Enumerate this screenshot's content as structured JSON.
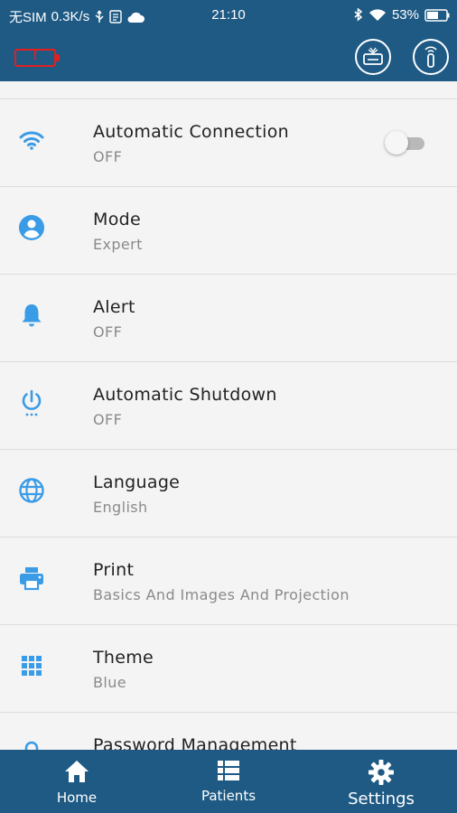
{
  "status_bar": {
    "carrier": "无SIM",
    "speed": "0.3K/s",
    "time": "21:10",
    "battery_percent": "53%"
  },
  "app_bar": {
    "battery_warning_symbol": "!"
  },
  "settings": [
    {
      "icon": "wifi-icon",
      "title": "Automatic Connection",
      "value": "OFF",
      "toggle": false
    },
    {
      "icon": "account-icon",
      "title": "Mode",
      "value": "Expert"
    },
    {
      "icon": "bell-icon",
      "title": "Alert",
      "value": "OFF"
    },
    {
      "icon": "power-icon",
      "title": "Automatic Shutdown",
      "value": "OFF"
    },
    {
      "icon": "globe-icon",
      "title": "Language",
      "value": "English"
    },
    {
      "icon": "printer-icon",
      "title": "Print",
      "value": "Basics And Images And Projection"
    },
    {
      "icon": "grid-icon",
      "title": "Theme",
      "value": "Blue"
    },
    {
      "icon": "lock-icon",
      "title": "Password Management",
      "value": ""
    }
  ],
  "bottom_nav": {
    "home": "Home",
    "patients": "Patients",
    "settings": "Settings"
  },
  "colors": {
    "primary": "#1e5a84",
    "accent_icon": "#3a9be6",
    "warning": "#e02020"
  }
}
